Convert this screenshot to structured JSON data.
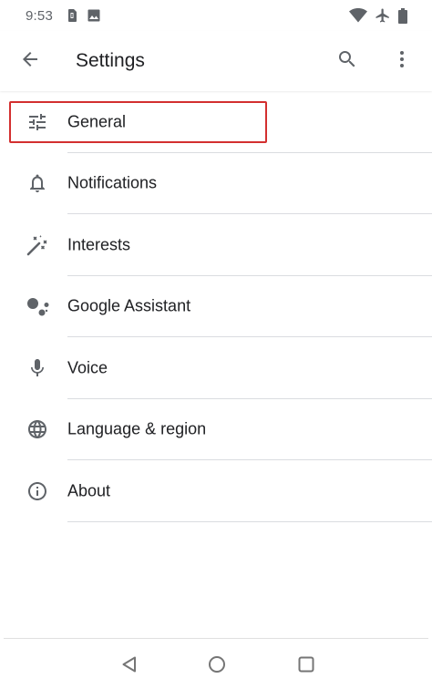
{
  "status_bar": {
    "time": "9:53",
    "left_icons": [
      "sim-card-icon",
      "image-icon"
    ],
    "right_icons": [
      "wifi-icon",
      "airplane-icon",
      "battery-icon"
    ]
  },
  "app_bar": {
    "back_icon": "arrow-back-icon",
    "title": "Settings",
    "search_icon": "search-icon",
    "more_icon": "more-vert-icon"
  },
  "settings": {
    "items": [
      {
        "id": "general",
        "label": "General",
        "icon": "tune-icon",
        "highlighted": true
      },
      {
        "id": "notifications",
        "label": "Notifications",
        "icon": "bell-icon"
      },
      {
        "id": "interests",
        "label": "Interests",
        "icon": "magic-wand-icon"
      },
      {
        "id": "google-assistant",
        "label": "Google Assistant",
        "icon": "assistant-icon"
      },
      {
        "id": "voice",
        "label": "Voice",
        "icon": "microphone-icon"
      },
      {
        "id": "language-region",
        "label": "Language & region",
        "icon": "globe-icon"
      },
      {
        "id": "about",
        "label": "About",
        "icon": "info-icon"
      }
    ]
  },
  "nav_bar": {
    "buttons": [
      "nav-back-icon",
      "nav-home-icon",
      "nav-recents-icon"
    ]
  },
  "colors": {
    "icon": "#5f6368",
    "text": "#202124",
    "divider": "#dadce0",
    "highlight": "#d32f2f"
  }
}
